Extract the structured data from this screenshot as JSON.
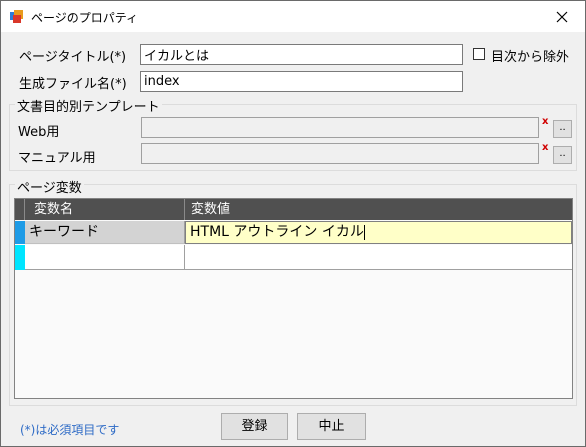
{
  "window": {
    "title": "ページのプロパティ"
  },
  "form": {
    "page_title_label": "ページタイトル(*)",
    "page_title_value": "イカルとは",
    "exclude_toc_label": "目次から除外",
    "filename_label": "生成ファイル名(*)",
    "filename_value": "index"
  },
  "template_group": {
    "legend": "文書目的別テンプレート",
    "web_label": "Web用",
    "web_value": "",
    "manual_label": "マニュアル用",
    "manual_value": "",
    "clear_symbol": "x",
    "browse_label": ".."
  },
  "variables": {
    "legend": "ページ変数",
    "columns": [
      "変数名",
      "変数値"
    ],
    "rows": [
      {
        "name": "キーワード",
        "value": "HTML アウトライン イカル"
      },
      {
        "name": "",
        "value": ""
      }
    ]
  },
  "footer": {
    "required_note": "(*)は必須項目です",
    "register_label": "登録",
    "cancel_label": "中止"
  },
  "colors": {
    "header_bg": "#505050",
    "row_indicator": "#1e9be6",
    "new_row_indicator": "#00e5ff",
    "edit_cell_bg": "#ffffc8",
    "required_note": "#2e6bc6"
  }
}
